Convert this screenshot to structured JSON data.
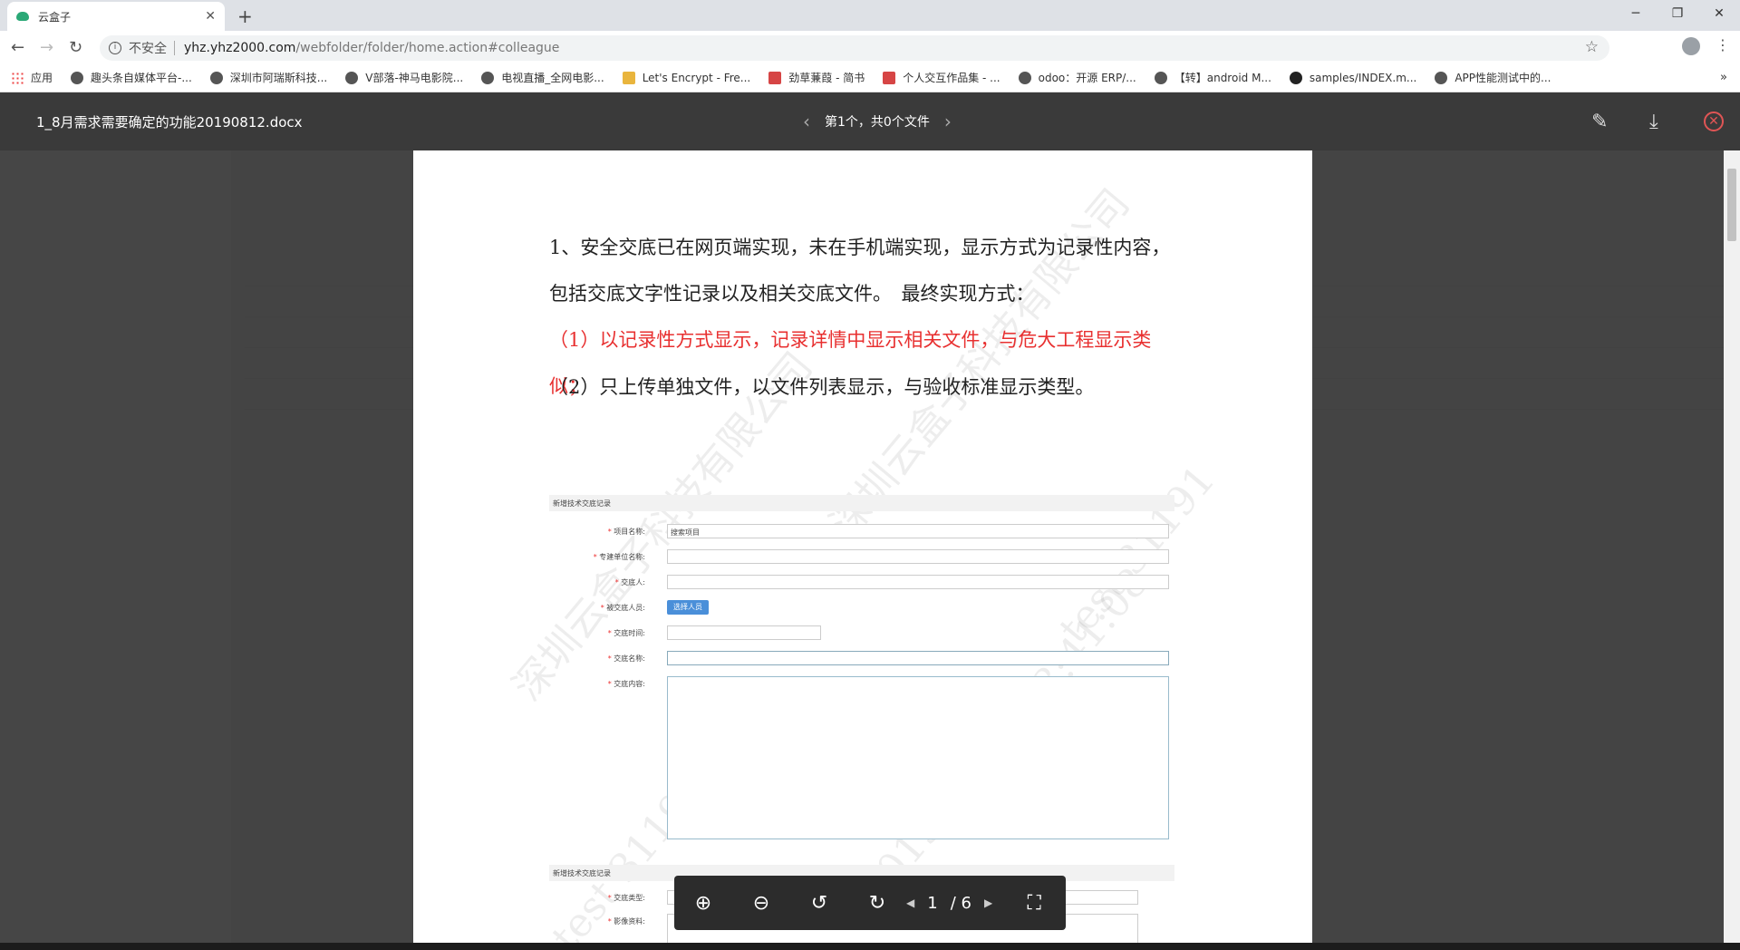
{
  "browser": {
    "tab_title": "云盒子",
    "insecure_label": "不安全",
    "url_host": "yhz.yhz2000.com",
    "url_path": "/webfolder/folder/home.action#colleague"
  },
  "bookmarks": [
    {
      "label": "应用",
      "icon": "apps-icon"
    },
    {
      "label": "趣头条自媒体平台-...",
      "icon": "globe-icon"
    },
    {
      "label": "深圳市阿瑞斯科技...",
      "icon": "globe-icon"
    },
    {
      "label": "V部落-神马电影院...",
      "icon": "globe-icon"
    },
    {
      "label": "电视直播_全网电影...",
      "icon": "globe-icon"
    },
    {
      "label": "Let's Encrypt - Fre...",
      "icon": "lock-icon"
    },
    {
      "label": "劲草蒹葭 - 简书",
      "icon": "jianshu-icon"
    },
    {
      "label": "个人交互作品集 - ...",
      "icon": "jianshu-icon"
    },
    {
      "label": "odoo：开源 ERP/...",
      "icon": "bird-icon"
    },
    {
      "label": "【转】android M...",
      "icon": "bird-icon"
    },
    {
      "label": "samples/INDEX.m...",
      "icon": "github-icon"
    },
    {
      "label": "APP性能测试中的...",
      "icon": "bird-icon"
    }
  ],
  "viewer": {
    "title": "1_8月需求需要确定的功能20190812.docx",
    "pager_text": "第1个，共0个文件",
    "page_current": "1",
    "page_total": "/ 6"
  },
  "document": {
    "para1": "1、安全交底已在网页端实现，未在手机端实现，显示方式为记录性内容，包括交底文字性记录以及相关交底文件。　最终实现方式：",
    "para2": "（1）以记录性方式显示，记录详情中显示相关文件，与危大工程显示类似；",
    "para3": "（2）只上传单独文件，以文件列表显示，与验收标准显示类型。",
    "watermark_line1": "深圳云盒子科技有限公司",
    "watermark_line2": "test 31191",
    "watermark_line3": "2019-09-17 23:41:08",
    "form": {
      "header": "新增技术交底记录",
      "fields": [
        {
          "label": "项目名称:",
          "value": "搜索项目"
        },
        {
          "label": "专建单位名称:",
          "value": ""
        },
        {
          "label": "交底人:",
          "value": ""
        },
        {
          "label": "被交底人员:",
          "value": "选择人员"
        },
        {
          "label": "交底时间:",
          "value": ""
        },
        {
          "label": "交底名称:",
          "value": ""
        },
        {
          "label": "交底内容:",
          "value": ""
        }
      ],
      "header2": "新增技术交底记录",
      "field_type": "交底类型:",
      "field_image": "影像资料:"
    }
  }
}
